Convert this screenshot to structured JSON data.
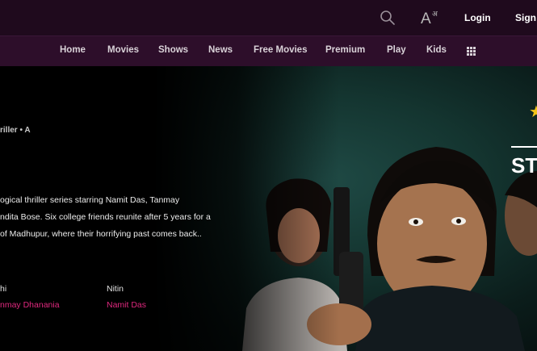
{
  "header": {
    "login_label": "Login",
    "signup_label": "Sign",
    "lang_glyph_big": "A",
    "lang_glyph_small": "अ",
    "search_icon": "search-icon",
    "colors": {
      "top_bg": "#1f0a1d",
      "nav_bg": "#2d0e2a",
      "accent": "#e0287e"
    }
  },
  "nav": {
    "items": [
      "Home",
      "Movies",
      "Shows",
      "News",
      "Free Movies",
      "Premium",
      "Play",
      "Kids"
    ],
    "apps_icon": "grid-icon"
  },
  "hero": {
    "meta": "riller • A",
    "description_lines": [
      "ogical thriller series starring Namit Das, Tanmay",
      "ndita Bose. Six college friends reunite after 5 years for a",
      "of Madhupur, where their horrifying past comes back.."
    ],
    "cast": [
      {
        "role": "hi",
        "name": "nmay Dhanania"
      },
      {
        "role": "Nitin",
        "name": "Namit Das"
      }
    ],
    "title_partial": "STI"
  }
}
